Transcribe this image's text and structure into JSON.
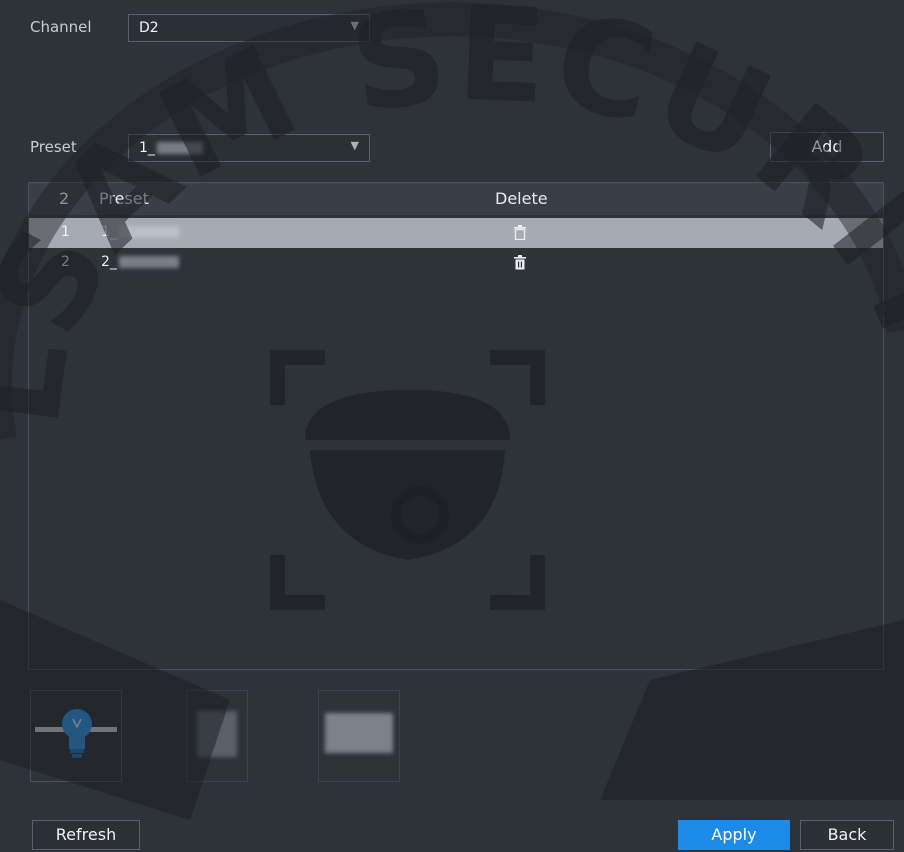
{
  "channel": {
    "label": "Channel",
    "value": "D2"
  },
  "preset": {
    "label": "Preset",
    "value": "1_",
    "add_label": "Add"
  },
  "table": {
    "headers": {
      "index": "2",
      "preset": "Preset",
      "delete": "Delete"
    },
    "rows": [
      {
        "index": "1",
        "name": "1_",
        "selected": true
      },
      {
        "index": "2",
        "name": "2_",
        "selected": false
      }
    ]
  },
  "thumbnails": [
    {
      "icon": "light-bulb-icon"
    },
    {
      "icon": "preset-image"
    },
    {
      "icon": "preset-image"
    }
  ],
  "footer": {
    "refresh_label": "Refresh",
    "apply_label": "Apply",
    "back_label": "Back"
  },
  "watermark": {
    "text": "LSAM SECURIT",
    "icon": "dome-camera-icon"
  },
  "colors": {
    "accent": "#1c8be8",
    "background": "#2e3239",
    "selected_row": "#a6abb3"
  }
}
